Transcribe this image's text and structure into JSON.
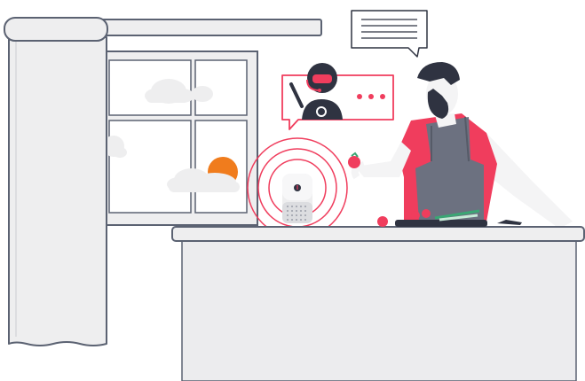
{
  "scene": {
    "description_tags": [
      "kitchen",
      "smart-speaker",
      "assistant-bot",
      "man-cooking",
      "window",
      "curtain",
      "sun",
      "cloud",
      "tomatoes",
      "cutting-board",
      "knife"
    ],
    "colors": {
      "outline": "#5b6272",
      "wall_light": "#eeeeef",
      "counter": "#ececee",
      "accent_red": "#f03d5d",
      "accent_orange": "#f07c1d",
      "hair_dark": "#2f3341",
      "apron": "#6c7180",
      "skin": "#f4f4f5",
      "bubble_fill": "#ffffff",
      "leaf_green": "#3aa774"
    },
    "icons": {
      "speaker": "smart-speaker-icon",
      "assistant": "assistant-robot-icon",
      "chat_bubble": "chat-bubble-icon",
      "typing_dots": "typing-dots-icon"
    }
  }
}
